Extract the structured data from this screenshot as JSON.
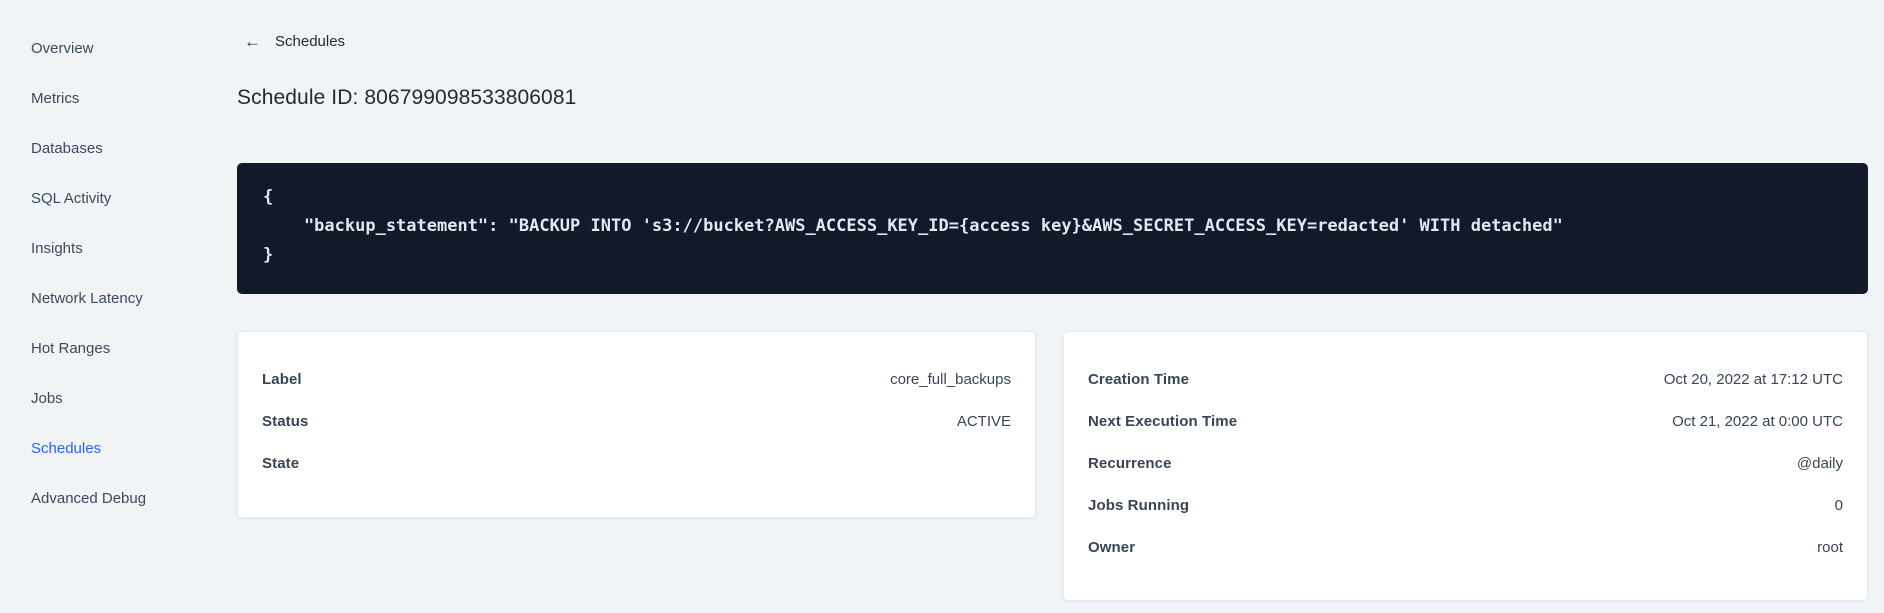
{
  "colors": {
    "background": "#f0f4f7",
    "accent_blue": "#2962ff",
    "code_background": "#121a29",
    "code_text": "#e2e7f0",
    "text_dark": "#242a35",
    "text_slate": "#394455"
  },
  "icons": {
    "back_arrow": "←"
  },
  "sidebar": {
    "items": [
      {
        "label": "Overview",
        "active": false
      },
      {
        "label": "Metrics",
        "active": false
      },
      {
        "label": "Databases",
        "active": false
      },
      {
        "label": "SQL Activity",
        "active": false
      },
      {
        "label": "Insights",
        "active": false
      },
      {
        "label": "Network Latency",
        "active": false
      },
      {
        "label": "Hot Ranges",
        "active": false
      },
      {
        "label": "Jobs",
        "active": false
      },
      {
        "label": "Schedules",
        "active": true
      },
      {
        "label": "Advanced Debug",
        "active": false
      }
    ]
  },
  "header": {
    "back_label": "Schedules",
    "title": "Schedule ID: 806799098533806081"
  },
  "code_block": {
    "lines": [
      "{",
      "    \"backup_statement\": \"BACKUP INTO 's3://bucket?AWS_ACCESS_KEY_ID={access key}&AWS_SECRET_ACCESS_KEY=redacted' WITH detached\"",
      "}"
    ]
  },
  "details_left": {
    "rows": [
      {
        "label": "Label",
        "value": "core_full_backups"
      },
      {
        "label": "Status",
        "value": "ACTIVE"
      },
      {
        "label": "State",
        "value": ""
      }
    ]
  },
  "details_right": {
    "rows": [
      {
        "label": "Creation Time",
        "value": "Oct 20, 2022 at 17:12 UTC"
      },
      {
        "label": "Next Execution Time",
        "value": "Oct 21, 2022 at 0:00 UTC"
      },
      {
        "label": "Recurrence",
        "value": "@daily"
      },
      {
        "label": "Jobs Running",
        "value": "0"
      },
      {
        "label": "Owner",
        "value": "root"
      }
    ]
  }
}
